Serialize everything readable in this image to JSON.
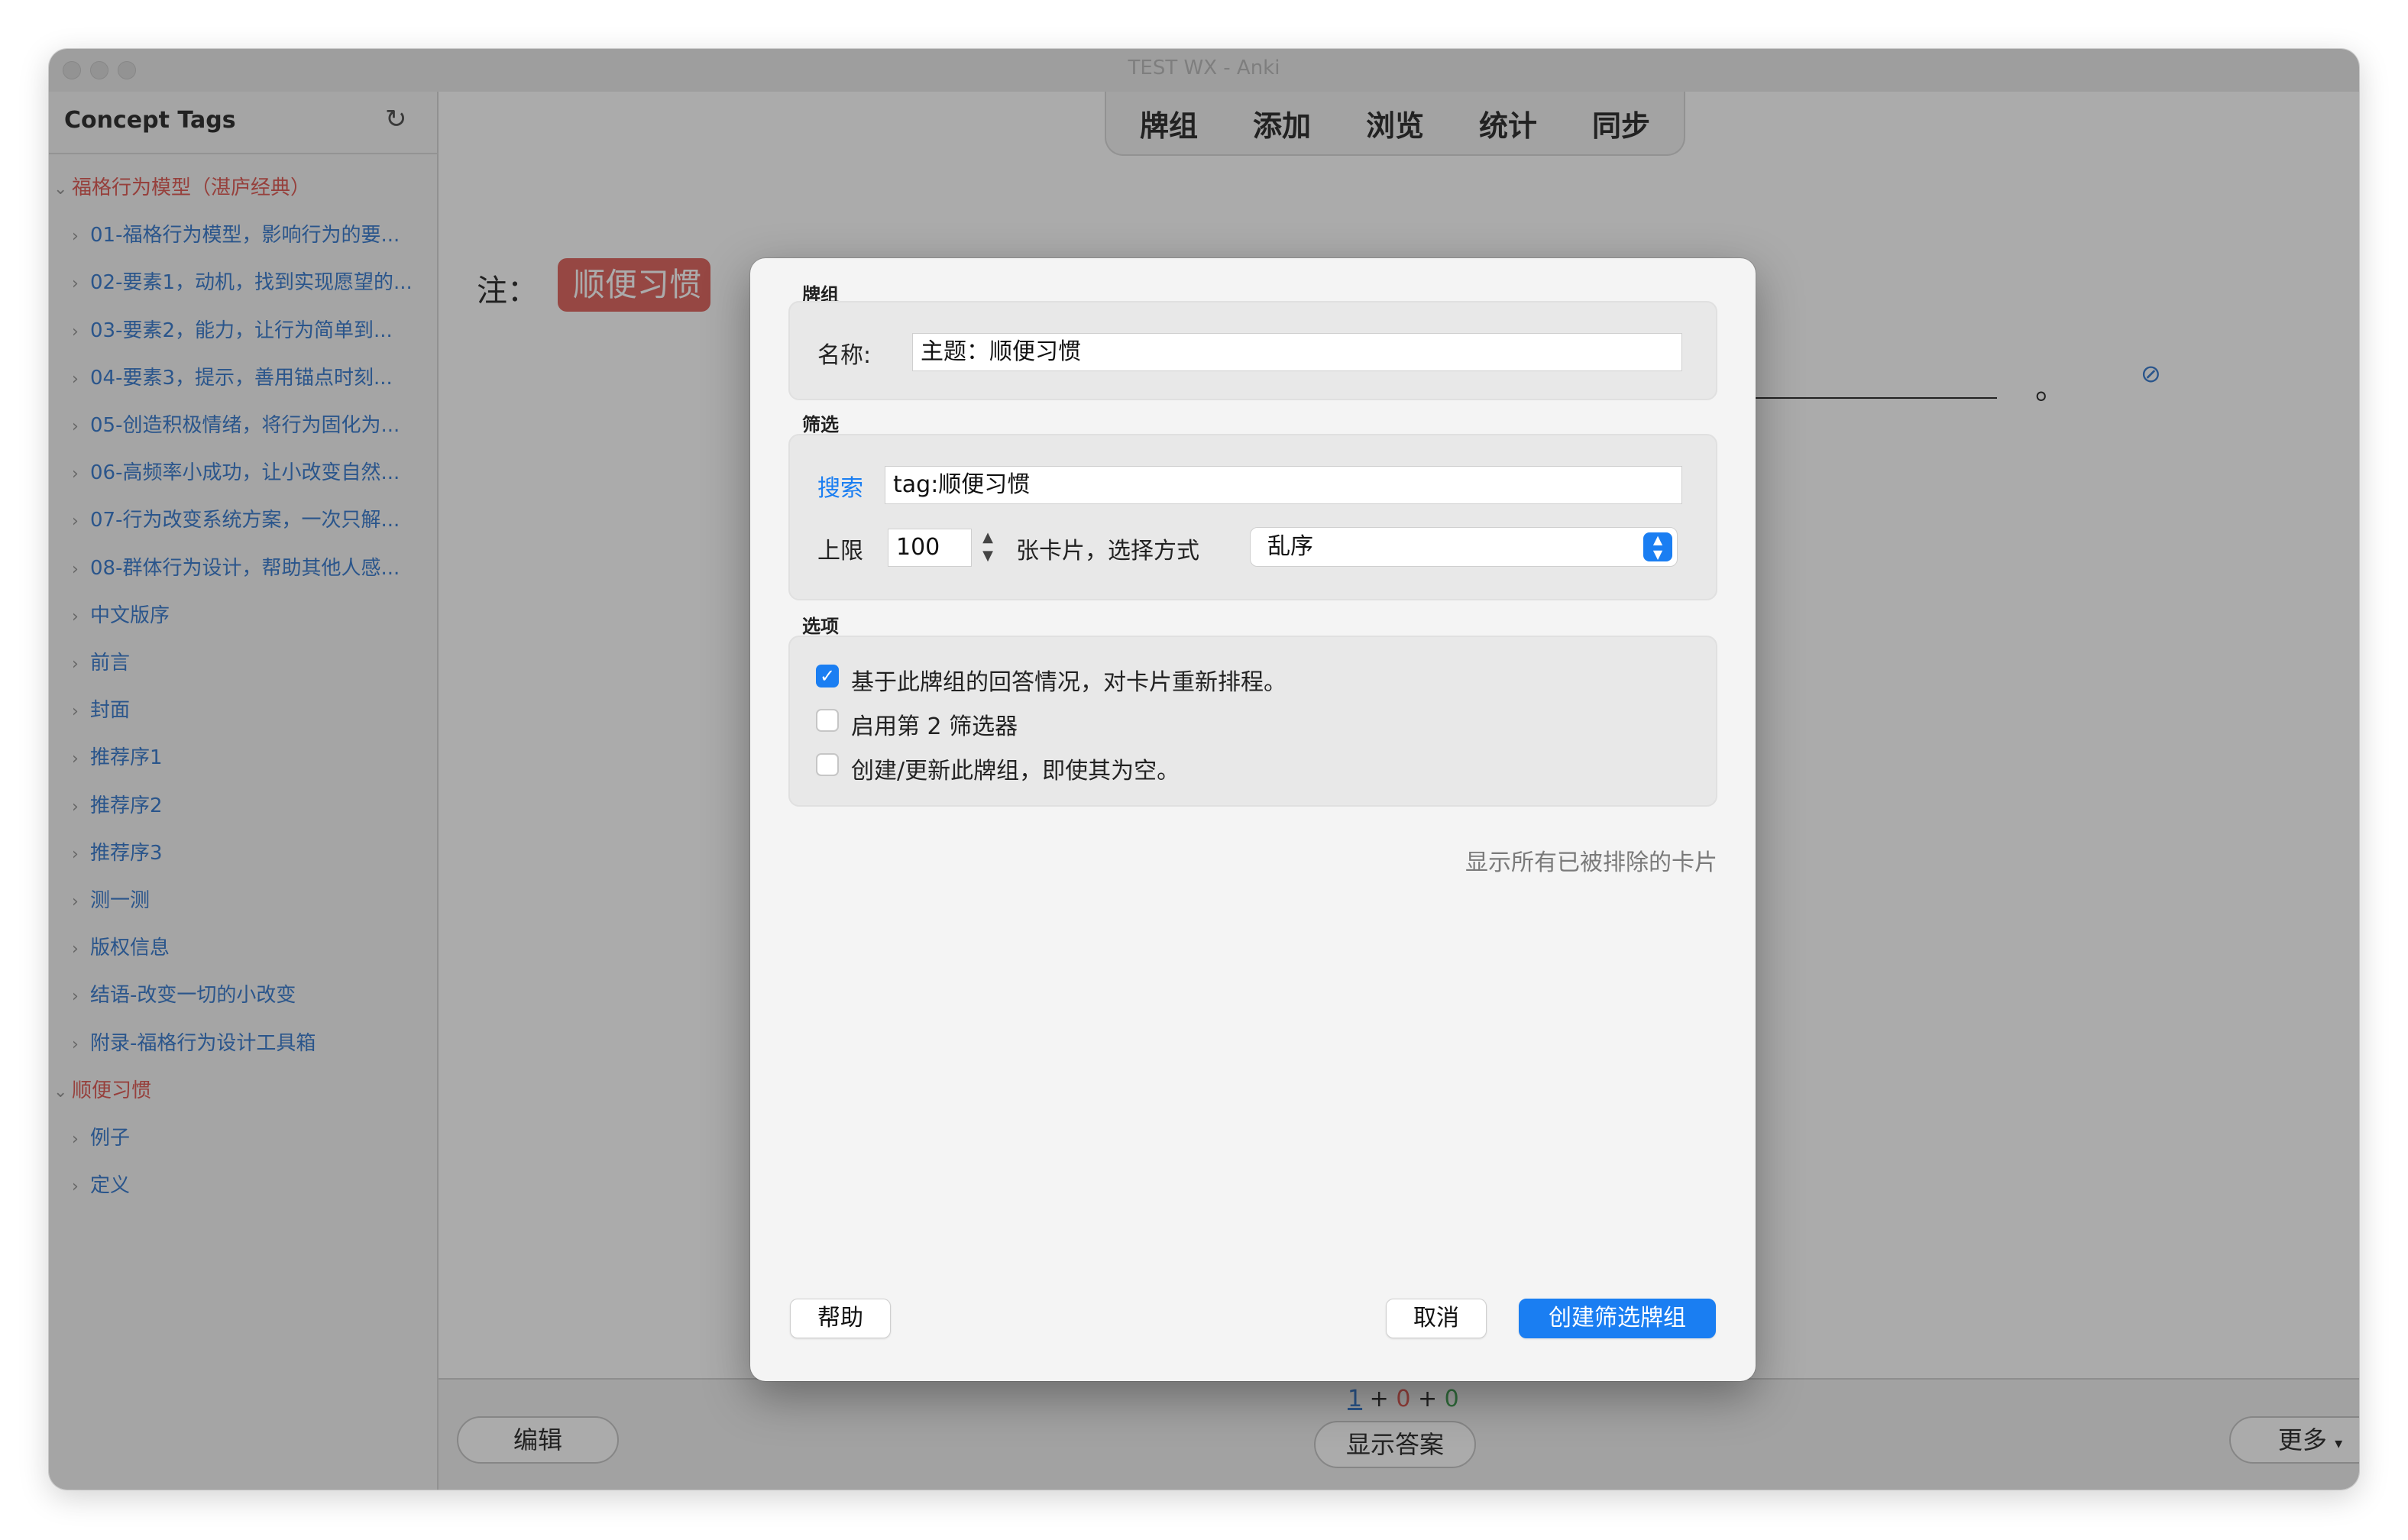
{
  "window": {
    "title": "TEST WX - Anki"
  },
  "sidebar": {
    "header": "Concept Tags",
    "tree": [
      {
        "label": "福格行为模型（湛庐经典）",
        "level": 0
      },
      {
        "label": "01-福格行为模型，影响行为的要...",
        "level": 1
      },
      {
        "label": "02-要素1，动机，找到实现愿望的...",
        "level": 1
      },
      {
        "label": "03-要素2，能力，让行为简单到...",
        "level": 1
      },
      {
        "label": "04-要素3，提示，善用锚点时刻...",
        "level": 1
      },
      {
        "label": "05-创造积极情绪，将行为固化为...",
        "level": 1
      },
      {
        "label": "06-高频率小成功，让小改变自然...",
        "level": 1
      },
      {
        "label": "07-行为改变系统方案，一次只解...",
        "level": 1
      },
      {
        "label": "08-群体行为设计，帮助其他人感...",
        "level": 1
      },
      {
        "label": "中文版序",
        "level": 1
      },
      {
        "label": "前言",
        "level": 1
      },
      {
        "label": "封面",
        "level": 1
      },
      {
        "label": "推荐序1",
        "level": 1
      },
      {
        "label": "推荐序2",
        "level": 1
      },
      {
        "label": "推荐序3",
        "level": 1
      },
      {
        "label": "测一测",
        "level": 1
      },
      {
        "label": "版权信息",
        "level": 1
      },
      {
        "label": "结语-改变一切的小改变",
        "level": 1
      },
      {
        "label": "附录-福格行为设计工具箱",
        "level": 1
      },
      {
        "label": "顺便习惯",
        "level": 0
      },
      {
        "label": "例子",
        "level": 1
      },
      {
        "label": "定义",
        "level": 1
      }
    ]
  },
  "toolbar": {
    "buttons": [
      "牌组",
      "添加",
      "浏览",
      "统计",
      "同步"
    ]
  },
  "card": {
    "note_label": "注：",
    "tag_text": "顺便习惯",
    "trailing": "。"
  },
  "bottom": {
    "edit_label": "编辑",
    "show_answer_label": "显示答案",
    "more_label": "更多",
    "count_new": "1",
    "count_learn": "0",
    "count_review": "0",
    "plus": "+"
  },
  "dialog": {
    "deck_section": "牌组",
    "name_label": "名称:",
    "name_value": "主题：顺便习惯",
    "filter_section": "筛选",
    "search_label": "搜索",
    "search_value": "tag:顺便习惯",
    "limit_label": "上限",
    "limit_value": "100",
    "cards_label": "张卡片，选择方式",
    "order_value": "乱序",
    "options_section": "选项",
    "opt1": "基于此牌组的回答情况，对卡片重新排程。",
    "opt1_checked": true,
    "opt2": "启用第 2 筛选器",
    "opt2_checked": false,
    "opt3": "创建/更新此牌组，即使其为空。",
    "opt3_checked": false,
    "show_excluded": "显示所有已被排除的卡片",
    "help_label": "帮助",
    "cancel_label": "取消",
    "create_label": "创建筛选牌组"
  },
  "colors": {
    "accent": "#1a7ef2",
    "parent_tag": "#e0605a",
    "child_tag": "#3f7fd0",
    "new_count": "#3f7fd0",
    "learn_count": "#e0605a",
    "review_count": "#4aa35a"
  }
}
